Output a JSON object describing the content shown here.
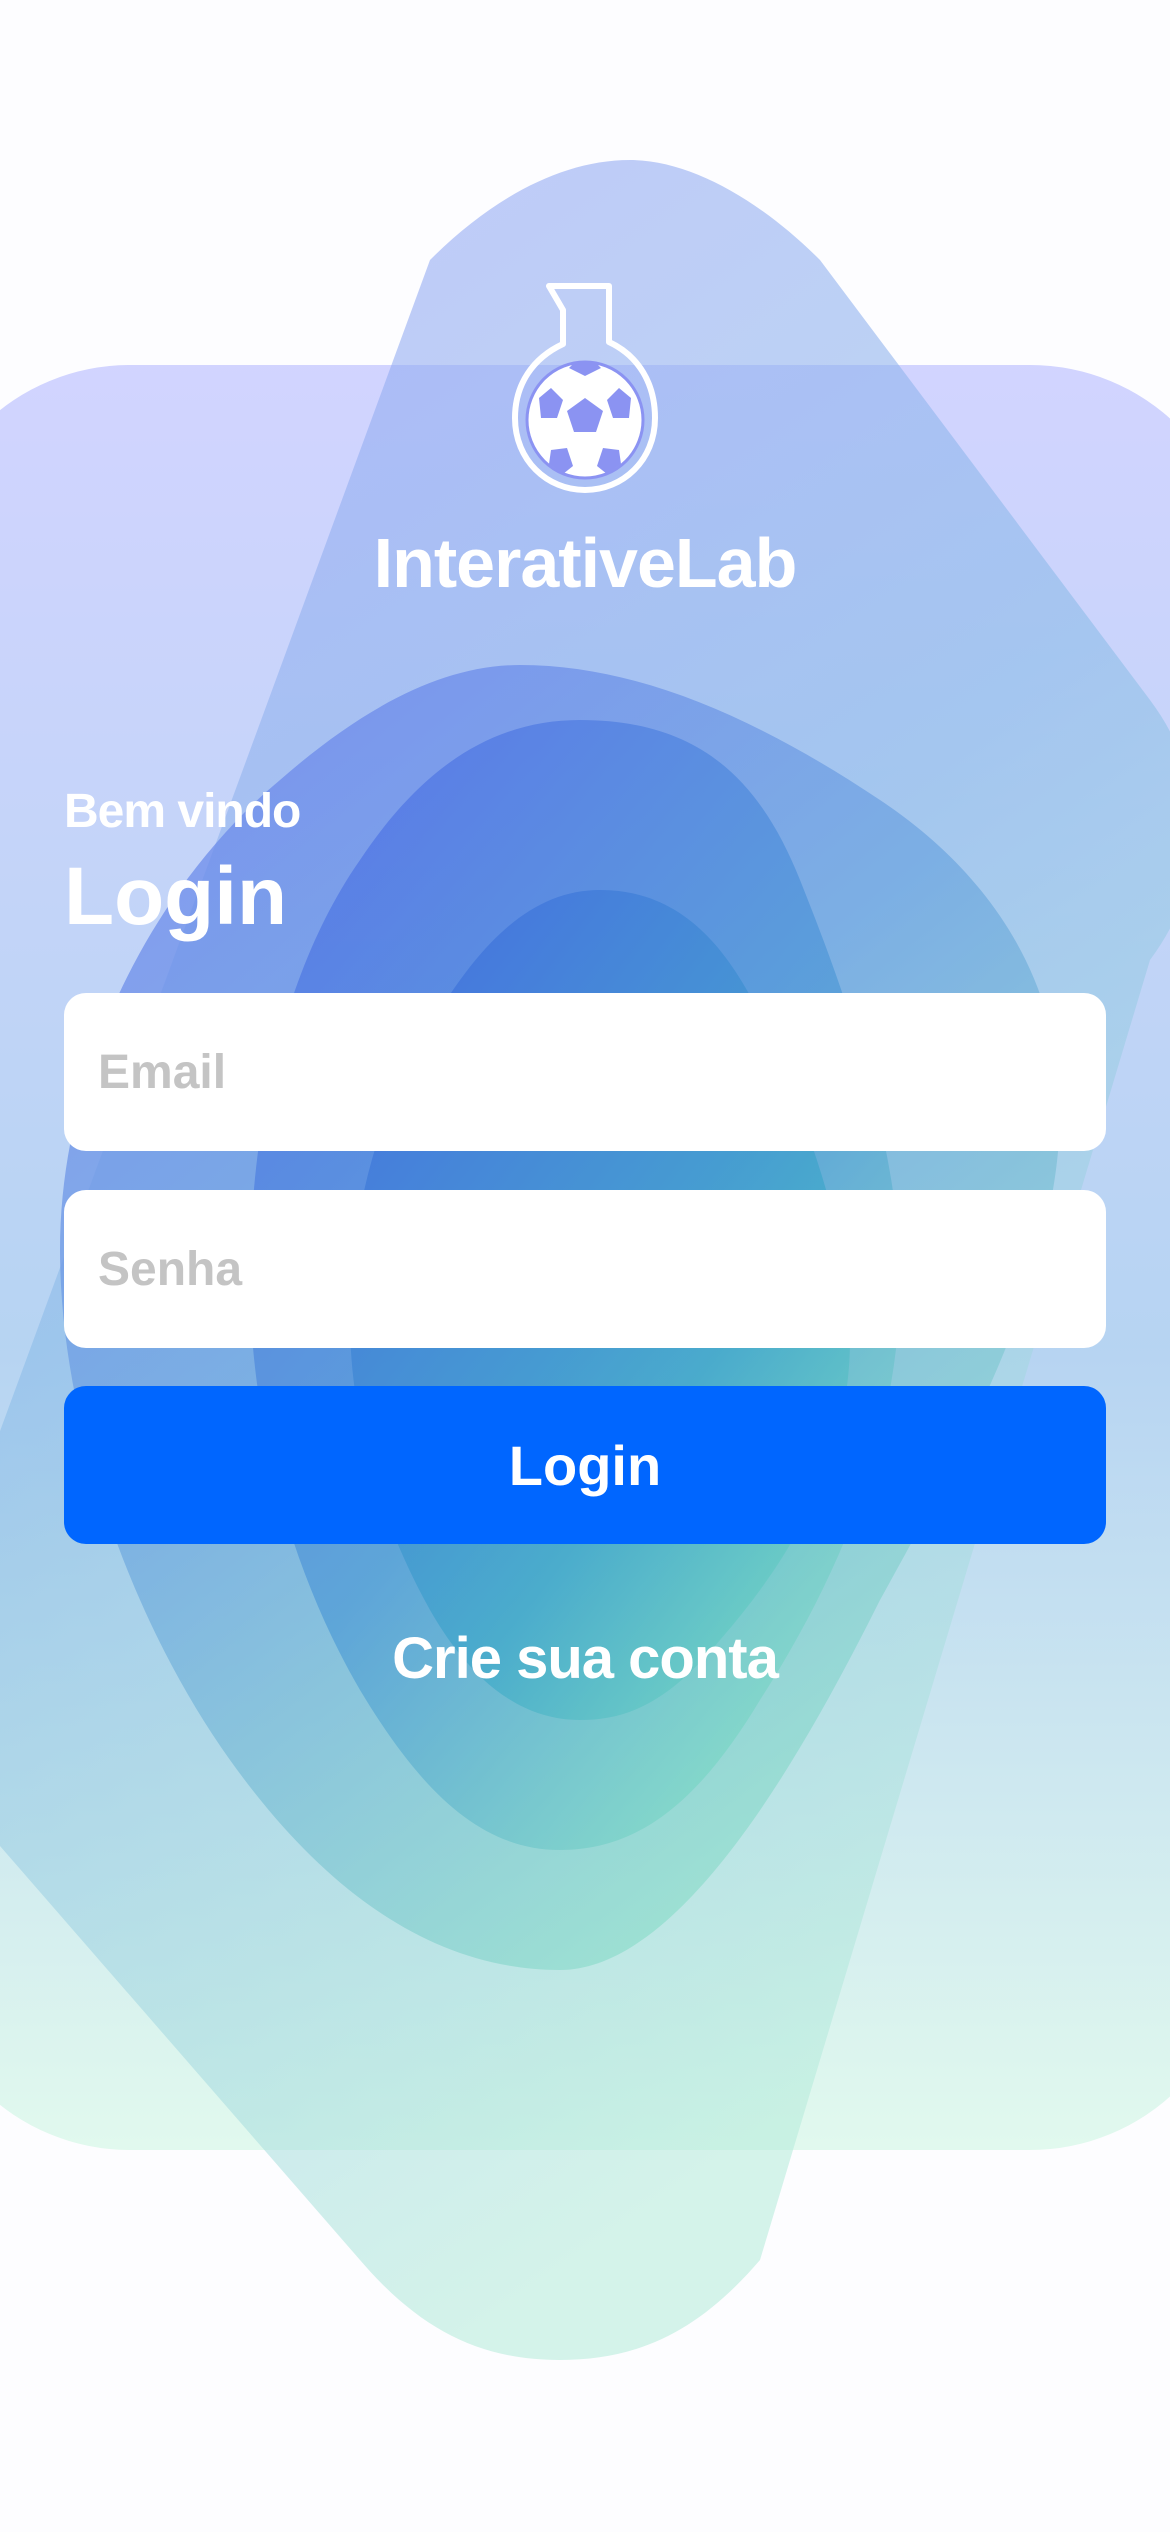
{
  "app": {
    "name": "InterativeLab",
    "logo_icon": "flask-soccer-ball-icon"
  },
  "login": {
    "welcome": "Bem vindo",
    "heading": "Login",
    "email_placeholder": "Email",
    "email_value": "",
    "password_placeholder": "Senha",
    "password_value": "",
    "submit_label": "Login",
    "create_account_label": "Crie sua conta"
  },
  "colors": {
    "primary_button": "#0066ff",
    "gradient_top": "#4a5cf0",
    "gradient_bottom": "#6fe0b0",
    "text_on_background": "#ffffff",
    "placeholder": "#c4c4c4"
  }
}
